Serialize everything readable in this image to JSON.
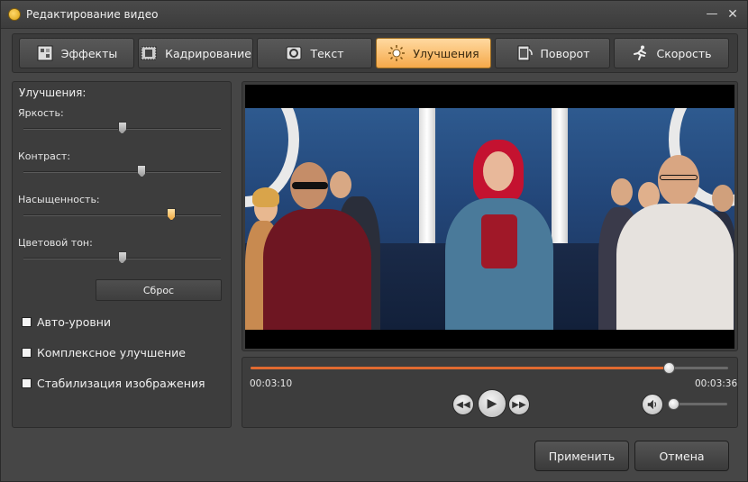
{
  "window": {
    "title": "Редактирование видео",
    "minimize_glyph": "—",
    "close_glyph": "✕"
  },
  "tabs": [
    {
      "label": "Эффекты",
      "icon": "effects-icon",
      "active": false
    },
    {
      "label": "Кадрирование",
      "icon": "crop-icon",
      "active": false
    },
    {
      "label": "Текст",
      "icon": "text-icon",
      "active": false
    },
    {
      "label": "Улучшения",
      "icon": "enhance-icon",
      "active": true
    },
    {
      "label": "Поворот",
      "icon": "rotate-icon",
      "active": false
    },
    {
      "label": "Скорость",
      "icon": "speed-icon",
      "active": false
    }
  ],
  "enhancements": {
    "heading": "Улучшения:",
    "sliders": [
      {
        "label": "Яркость:",
        "value": 0.5
      },
      {
        "label": "Контраст:",
        "value": 0.6
      },
      {
        "label": "Насыщенность:",
        "value": 0.75
      },
      {
        "label": "Цветовой тон:",
        "value": 0.5
      }
    ],
    "reset_label": "Сброс",
    "checkboxes": [
      {
        "label": "Авто-уровни",
        "checked": false
      },
      {
        "label": "Комплексное улучшение",
        "checked": false
      },
      {
        "label": "Стабилизация изображения",
        "checked": false
      }
    ]
  },
  "player": {
    "current_time": "00:03:10",
    "total_time": "00:03:36",
    "progress": 0.875,
    "volume": 0.0
  },
  "buttons": {
    "apply": "Применить",
    "cancel": "Отмена"
  },
  "colors": {
    "accent_tab": "#f5a94a",
    "progress": "#e06a30"
  }
}
